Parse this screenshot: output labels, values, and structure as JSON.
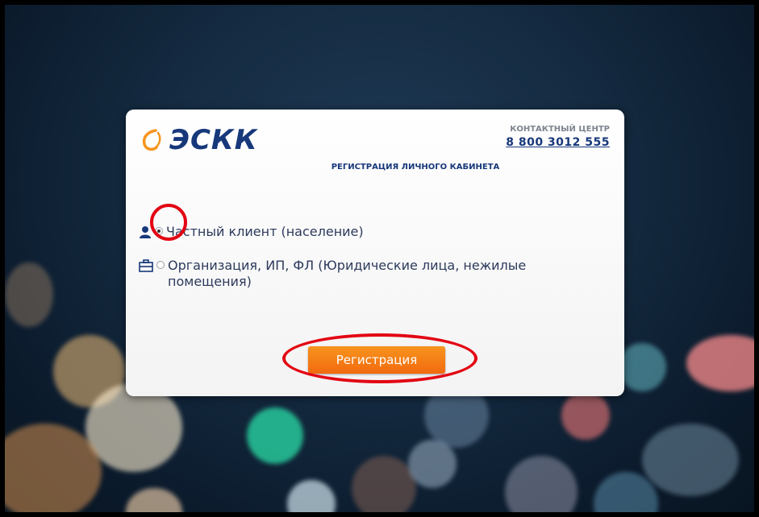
{
  "brand": {
    "name": "ЭСКК",
    "logo_icon": "swoosh-logo-icon",
    "logo_color": "#f7941d",
    "text_color": "#17387a"
  },
  "contact": {
    "label": "КОНТАКТНЫЙ ЦЕНТР",
    "phone": "8 800 3012 555"
  },
  "form": {
    "title": "РЕГИСТРАЦИЯ ЛИЧНОГО КАБИНЕТА",
    "options": [
      {
        "label": "Частный клиент (население)",
        "icon": "person-icon",
        "selected": true
      },
      {
        "label": "Организация, ИП, ФЛ (Юридические лица, нежилые помещения)",
        "icon": "briefcase-icon",
        "selected": false
      }
    ],
    "submit_label": "Регистрация"
  },
  "colors": {
    "button": "#f7941d",
    "highlight_ring": "#e30613"
  }
}
